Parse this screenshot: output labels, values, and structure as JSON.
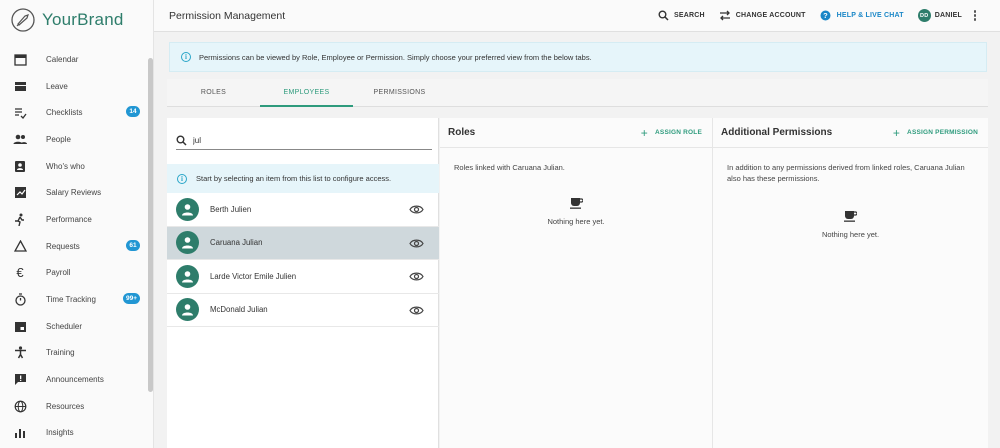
{
  "brand": {
    "name": "YourBrand"
  },
  "sidebar": {
    "items": [
      {
        "label": "Calendar",
        "icon": "calendar-icon",
        "badge": ""
      },
      {
        "label": "Leave",
        "icon": "leave-icon",
        "badge": ""
      },
      {
        "label": "Checklists",
        "icon": "checklist-icon",
        "badge": "14"
      },
      {
        "label": "People",
        "icon": "people-icon",
        "badge": ""
      },
      {
        "label": "Who's who",
        "icon": "contact-card-icon",
        "badge": ""
      },
      {
        "label": "Salary Reviews",
        "icon": "salary-chart-icon",
        "badge": ""
      },
      {
        "label": "Performance",
        "icon": "running-person-icon",
        "badge": ""
      },
      {
        "label": "Requests",
        "icon": "triangle-icon",
        "badge": "61"
      },
      {
        "label": "Payroll",
        "icon": "euro-icon",
        "badge": ""
      },
      {
        "label": "Time Tracking",
        "icon": "stopwatch-icon",
        "badge": "99+"
      },
      {
        "label": "Scheduler",
        "icon": "scheduler-icon",
        "badge": ""
      },
      {
        "label": "Training",
        "icon": "training-icon",
        "badge": ""
      },
      {
        "label": "Announcements",
        "icon": "announcement-icon",
        "badge": ""
      },
      {
        "label": "Resources",
        "icon": "globe-icon",
        "badge": ""
      },
      {
        "label": "Insights",
        "icon": "bar-chart-icon",
        "badge": ""
      }
    ]
  },
  "topbar": {
    "title": "Permission Management",
    "search_label": "SEARCH",
    "change_account_label": "CHANGE ACCOUNT",
    "help_label": "HELP & LIVE CHAT",
    "user_initials": "DD",
    "user_name": "DANIEL"
  },
  "info_banner": "Permissions can be viewed by Role, Employee or Permission. Simply choose your preferred view from the below tabs.",
  "tabs": [
    {
      "label": "ROLES",
      "active": false
    },
    {
      "label": "EMPLOYEES",
      "active": true
    },
    {
      "label": "PERMISSIONS",
      "active": false
    }
  ],
  "employees_panel": {
    "search_value": "jul",
    "hint": "Start by selecting an item from this list to configure access.",
    "employees": [
      {
        "name": "Berth Julien",
        "selected": false
      },
      {
        "name": "Caruana Julian",
        "selected": true
      },
      {
        "name": "Larde Victor Emile Julien",
        "selected": false
      },
      {
        "name": "McDonald Julian",
        "selected": false
      }
    ]
  },
  "roles_panel": {
    "title": "Roles",
    "assign_label": "ASSIGN ROLE",
    "description": "Roles linked with Caruana Julian.",
    "empty_text": "Nothing here yet."
  },
  "additional_panel": {
    "title": "Additional Permissions",
    "assign_label": "ASSIGN PERMISSION",
    "description": "In addition to any permissions derived from linked roles, Caruana Julian also has these permissions.",
    "empty_text": "Nothing here yet."
  },
  "colors": {
    "accent": "#2e9b7d",
    "avatar": "#2e7d6b",
    "badge": "#2196d3",
    "help": "#1a87c7",
    "info_bg": "#e6f5fa"
  }
}
